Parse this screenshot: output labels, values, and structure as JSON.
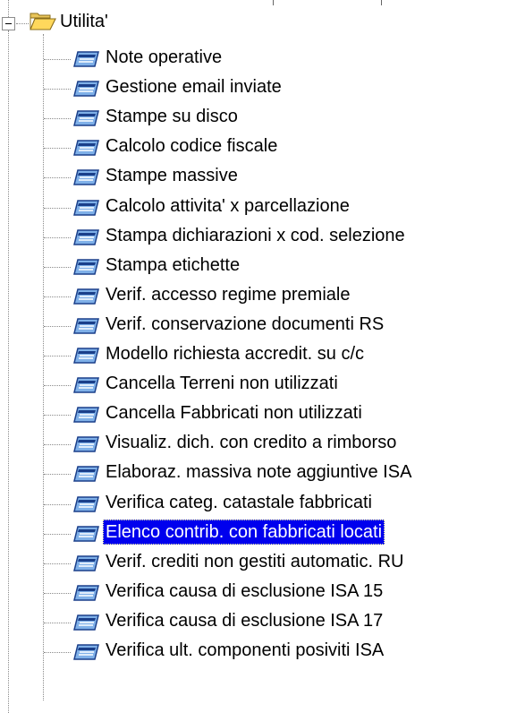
{
  "tree": {
    "root": {
      "label": "Utilita'",
      "icon": "folder-open-icon",
      "expanded": true
    },
    "items": [
      {
        "label": "Note operative",
        "icon": "form-icon"
      },
      {
        "label": "Gestione email inviate",
        "icon": "form-icon"
      },
      {
        "label": "Stampe su disco",
        "icon": "form-icon"
      },
      {
        "label": "Calcolo codice fiscale",
        "icon": "form-icon"
      },
      {
        "label": "Stampe massive",
        "icon": "form-icon"
      },
      {
        "label": "Calcolo attivita' x parcellazione",
        "icon": "form-icon"
      },
      {
        "label": "Stampa dichiarazioni x cod. selezione",
        "icon": "form-icon"
      },
      {
        "label": "Stampa etichette",
        "icon": "form-icon"
      },
      {
        "label": "Verif. accesso regime premiale",
        "icon": "form-icon"
      },
      {
        "label": "Verif. conservazione documenti RS",
        "icon": "form-icon"
      },
      {
        "label": "Modello richiesta accredit. su c/c",
        "icon": "form-icon"
      },
      {
        "label": "Cancella Terreni non utilizzati",
        "icon": "form-icon"
      },
      {
        "label": "Cancella Fabbricati non utilizzati",
        "icon": "form-icon"
      },
      {
        "label": "Visualiz. dich. con credito a rimborso",
        "icon": "form-icon"
      },
      {
        "label": "Elaboraz. massiva note aggiuntive ISA",
        "icon": "form-icon"
      },
      {
        "label": "Verifica categ. catastale fabbricati",
        "icon": "form-icon"
      },
      {
        "label": "Elenco contrib. con fabbricati locati",
        "icon": "form-icon",
        "selected": true
      },
      {
        "label": "Verif. crediti non gestiti automatic. RU",
        "icon": "form-icon"
      },
      {
        "label": "Verifica causa di esclusione ISA 15",
        "icon": "form-icon"
      },
      {
        "label": "Verifica causa di esclusione ISA 17",
        "icon": "form-icon"
      },
      {
        "label": "Verifica ult. componenti posiviti ISA",
        "icon": "form-icon"
      }
    ]
  },
  "colors": {
    "selection": "#0000ee",
    "selection_text": "#ffffff",
    "tree_lines": "#8a8a8a"
  }
}
